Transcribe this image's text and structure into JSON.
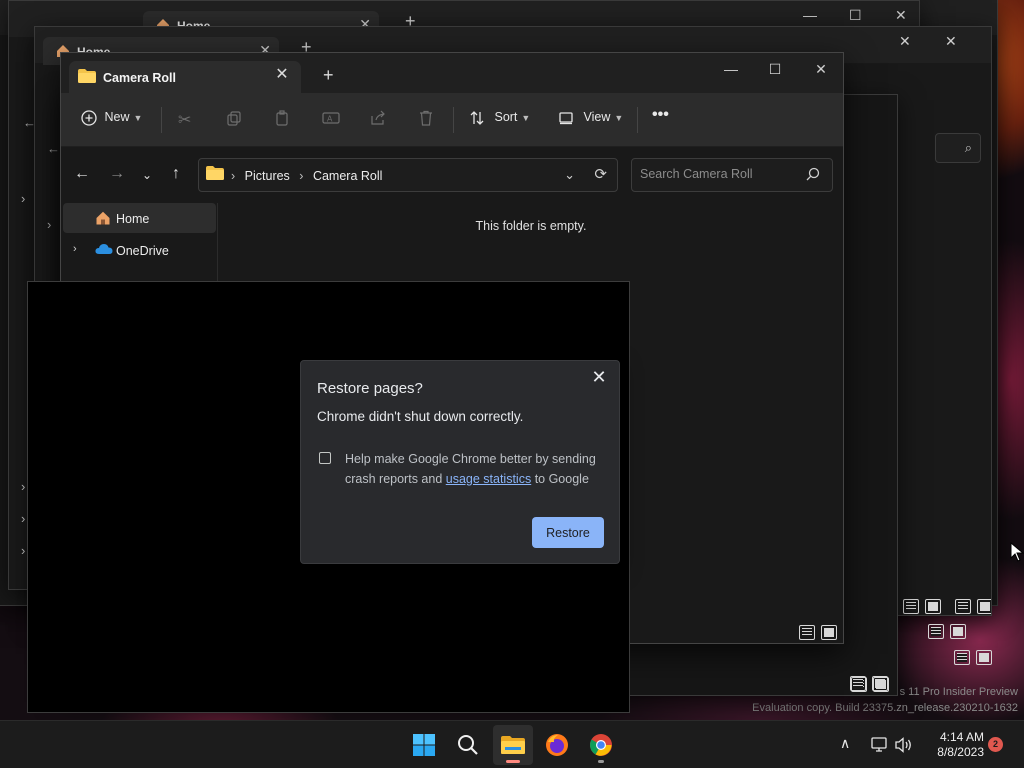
{
  "desktop": {
    "watermark_line1": "s 11 Pro Insider Preview",
    "watermark_line2": "Evaluation copy. Build 23375.zn_release.230210-1632",
    "wallpaper_accent": "#b64a18"
  },
  "background_windows": {
    "tab_label": "Home"
  },
  "explorer": {
    "tab_title": "Camera Roll",
    "toolbar": {
      "new_label": "New",
      "sort_label": "Sort",
      "view_label": "View",
      "more_label": "•••"
    },
    "address": {
      "crumbs": [
        "Pictures",
        "Camera Roll"
      ]
    },
    "search_placeholder": "Search Camera Roll",
    "nav_items": [
      {
        "label": "Home",
        "icon": "home-icon",
        "selected": true
      },
      {
        "label": "OneDrive",
        "icon": "onedrive-cloud-icon",
        "selected": false
      }
    ],
    "empty_message": "This folder is empty."
  },
  "dialog": {
    "title": "Restore pages?",
    "message": "Chrome didn't shut down correctly.",
    "help_prefix": "Help make Google Chrome better by sending crash reports and ",
    "help_link": "usage statistics",
    "help_suffix": " to Google",
    "checkbox_checked": false,
    "restore_label": "Restore",
    "accent": "#8ab4f8"
  },
  "taskbar": {
    "apps": [
      "start-button",
      "search-button",
      "file-explorer",
      "firefox",
      "chrome"
    ],
    "time": "4:14 AM",
    "date": "8/8/2023",
    "notification_count": "2"
  }
}
